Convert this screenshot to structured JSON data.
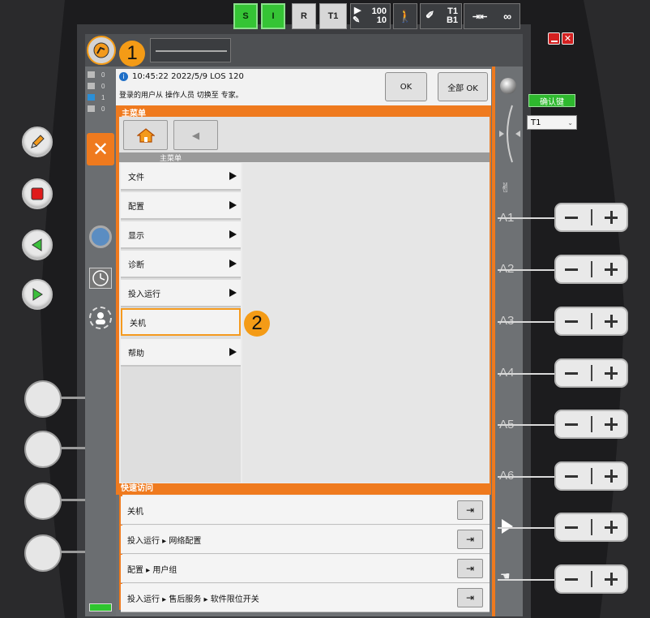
{
  "status_bar": {
    "mode_s": "S",
    "mode_i": "I",
    "mode_r": "R",
    "mode_t1": "T1",
    "override_top": "100",
    "override_bottom": "10",
    "tool_top": "T1",
    "tool_bottom": "B1",
    "incremental": "∞"
  },
  "left_counters": [
    "0",
    "0",
    "1",
    "0"
  ],
  "message": {
    "time_line": "10:45:22 2022/5/9 LOS 120",
    "text": "登录的用户从 操作人员 切换至 专家。",
    "ok_label": "OK",
    "all_ok_label": "全部 OK"
  },
  "main_menu": {
    "window_title": "主菜单",
    "header": "主菜单",
    "items": [
      {
        "label": "文件",
        "has_submenu": true
      },
      {
        "label": "配置",
        "has_submenu": true
      },
      {
        "label": "显示",
        "has_submenu": true
      },
      {
        "label": "诊断",
        "has_submenu": true
      },
      {
        "label": "投入运行",
        "has_submenu": true
      },
      {
        "label": "关机",
        "has_submenu": false
      },
      {
        "label": "帮助",
        "has_submenu": true
      }
    ]
  },
  "quick_access": {
    "title": "快速访问",
    "rows": [
      "关机",
      "投入运行 ▸ 网络配置",
      "配置 ▸ 用户组",
      "投入运行 ▸ 售后服务 ▸ 软件限位开关"
    ]
  },
  "right_panel": {
    "confirm_key": "确认键",
    "mode_select": "T1",
    "axes": [
      "A1",
      "A2",
      "A3",
      "A4",
      "A5",
      "A6"
    ]
  },
  "annotations": [
    "1",
    "2"
  ],
  "colors": {
    "accent": "#ef7a1e",
    "green": "#35c435",
    "badge": "#f49b16"
  }
}
